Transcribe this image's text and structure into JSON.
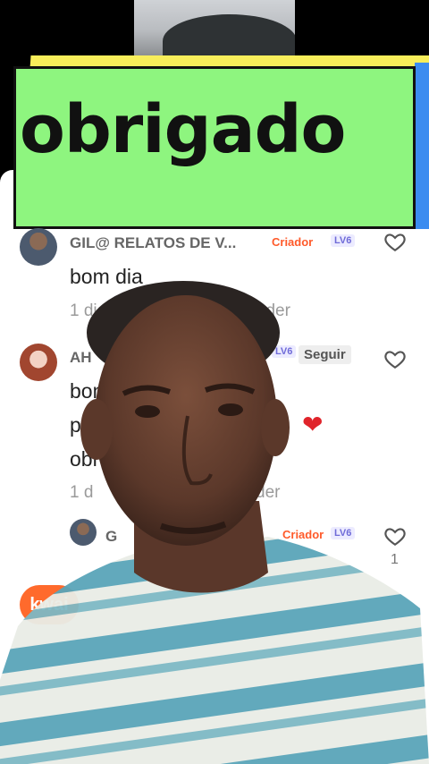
{
  "banner": {
    "text": "obrigado"
  },
  "comments": [
    {
      "author": "GIL@ RELATOS DE V...",
      "badge": "Criador",
      "level": "LV6",
      "text": "bom dia",
      "time": "1 dia",
      "reply": "Responder"
    },
    {
      "author": "AH",
      "level": "LV6",
      "follow": "Seguir",
      "lines": [
        "bom",
        "par",
        "obr"
      ],
      "emoji": "❤",
      "time": "1 d",
      "reply": "der"
    },
    {
      "author": "G",
      "badge": "Criador",
      "level": "LV6",
      "likes": "1"
    }
  ],
  "kwai_badge": "kwai",
  "icons": [
    "heart-outline-icon",
    "red-heart-emoji"
  ],
  "colors": {
    "banner_bg": "#8ef57f",
    "banner_shadow": "#f8ee5a",
    "accent_orange": "#ff5a2a",
    "level_purple": "#6f6bd8"
  }
}
